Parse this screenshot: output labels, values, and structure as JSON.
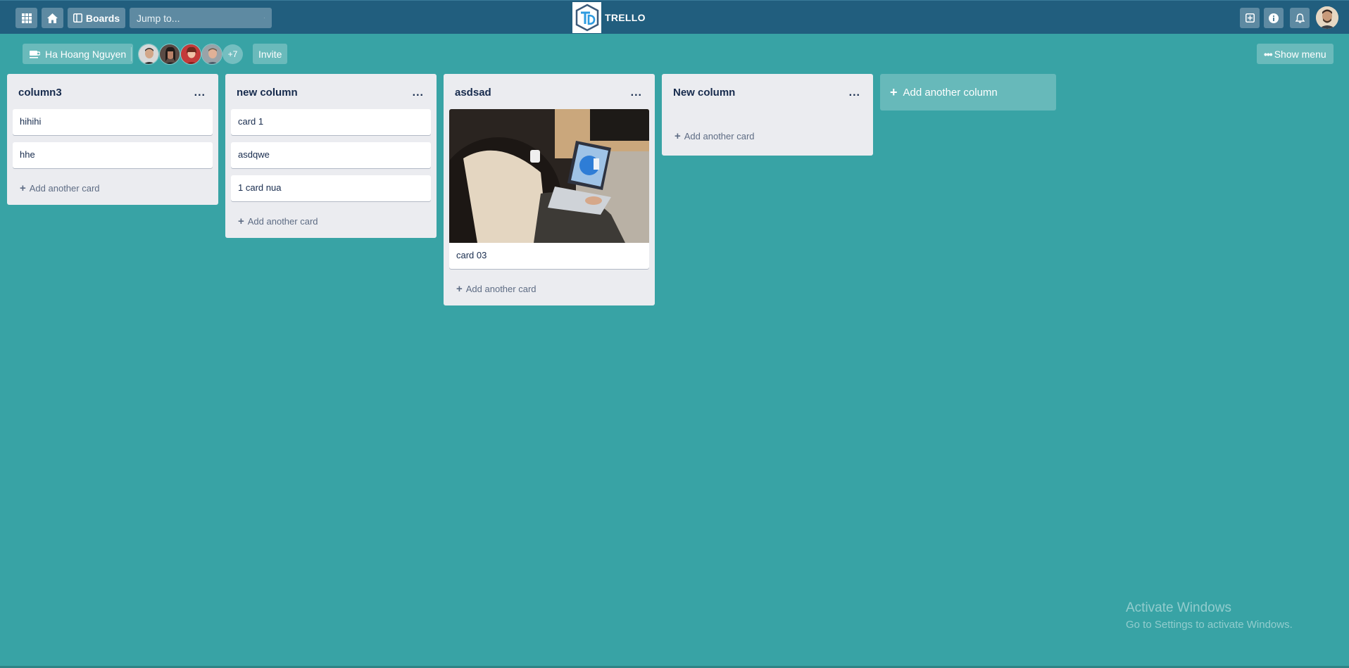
{
  "appbar": {
    "boards_label": "Boards",
    "search_placeholder": "Jump to...",
    "logo_text": "TRELLO"
  },
  "board": {
    "owner_label": "Ha Hoang Nguyen",
    "more_members": "+7",
    "invite_label": "Invite",
    "show_menu_label": "Show menu"
  },
  "columns": [
    {
      "title": "column3",
      "menu": "...",
      "cards": [
        "hihihi",
        "hhe"
      ],
      "add_label": "Add another card"
    },
    {
      "title": "new column",
      "menu": "...",
      "cards": [
        "card 1",
        "asdqwe",
        "1 card nua"
      ],
      "add_label": "Add another card"
    },
    {
      "title": "asdsad",
      "menu": "...",
      "cards": [
        "card 03"
      ],
      "add_label": "Add another card"
    },
    {
      "title": "New column",
      "menu": "...",
      "cards": [],
      "add_label": "Add another card"
    }
  ],
  "add_column_label": "Add another column",
  "watermark": {
    "line1": "Activate Windows",
    "line2": "Go to Settings to activate Windows."
  },
  "colors": {
    "appbar": "#215e7e",
    "board_bg": "#38a3a5",
    "column_bg": "#ebecf0"
  }
}
